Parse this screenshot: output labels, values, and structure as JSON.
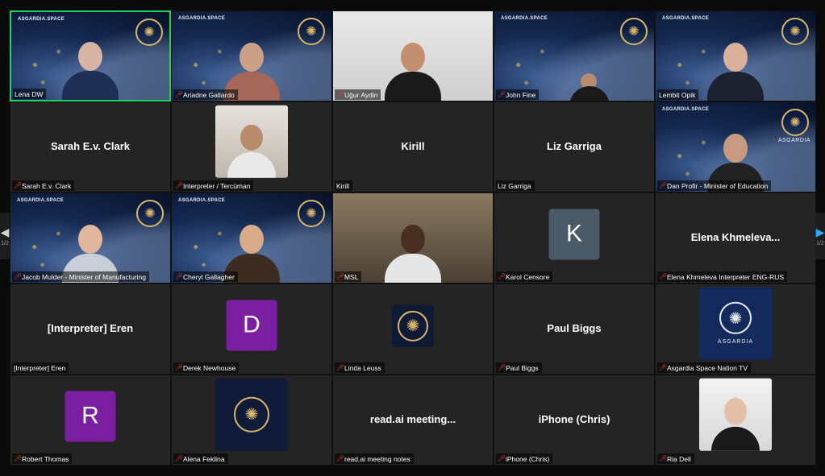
{
  "brand": "ASGARDIA.SPACE",
  "logo_text": "ASGARDIA",
  "pager": {
    "left": "1/2",
    "right": "1/2"
  },
  "tiles": [
    {
      "name": "Lena DW",
      "muted": false
    },
    {
      "name": "Ariadne Gallardo",
      "muted": true
    },
    {
      "name": "Uğur Aydin",
      "muted": true
    },
    {
      "name": "John Fine",
      "muted": true
    },
    {
      "name": "Lembit Opik",
      "muted": false
    },
    {
      "name": "Sarah E.v. Clark",
      "display": "Sarah E.v. Clark",
      "muted": true
    },
    {
      "name": "Interpreter / Tercüman",
      "muted": true
    },
    {
      "name": "Kirill",
      "display": "Kirill",
      "muted": false
    },
    {
      "name": "Liz Garriga",
      "display": "Liz Garriga",
      "muted": false
    },
    {
      "name": "Dan Profir - Minister of Education",
      "muted": true
    },
    {
      "name": "Jacob Mulder - Minister of Manufacturing",
      "muted": true
    },
    {
      "name": "Cheryl Gallagher",
      "muted": true
    },
    {
      "name": "MSL",
      "muted": true
    },
    {
      "name": "Karol Censore",
      "letter": "K",
      "muted": true
    },
    {
      "name": "Elena Khmeleva Interpreter ENG-RUS",
      "display": "Elena  Khmeleva...",
      "muted": true
    },
    {
      "name": "[Interpreter] Eren",
      "display": "[Interpreter] Eren",
      "muted": false
    },
    {
      "name": "Derek Newhouse",
      "letter": "D",
      "muted": true
    },
    {
      "name": "Linda Leuss",
      "muted": true
    },
    {
      "name": "Paul Biggs",
      "display": "Paul Biggs",
      "muted": true
    },
    {
      "name": "Asgardia Space Nation TV",
      "muted": true
    },
    {
      "name": "Robert Thomas",
      "letter": "R",
      "muted": true
    },
    {
      "name": "Alena Feklina",
      "muted": true
    },
    {
      "name": "read.ai meeting notes",
      "display": "read.ai  meeting...",
      "muted": true
    },
    {
      "name": "iPhone (Chris)",
      "display": "iPhone (Chris)",
      "muted": true
    },
    {
      "name": "Ria Dell",
      "muted": true
    }
  ],
  "colors": {
    "active_border": "#23d160",
    "mute_red": "#ff3b30",
    "tile_bg": "#242424",
    "letter_k": "#4a5a66",
    "letter_purple": "#7b1fa2"
  }
}
